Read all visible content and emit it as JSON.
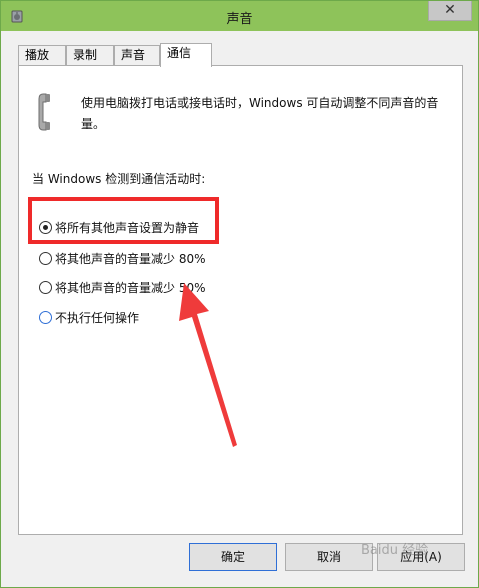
{
  "window": {
    "title": "声音"
  },
  "tabs": [
    {
      "label": "播放"
    },
    {
      "label": "录制"
    },
    {
      "label": "声音"
    },
    {
      "label": "通信"
    }
  ],
  "panel": {
    "description": "使用电脑拨打电话或接电话时，Windows 可自动调整不同声音的音量。",
    "section_label": "当 Windows 检测到通信活动时:",
    "options": [
      {
        "label": "将所有其他声音设置为静音",
        "checked": true
      },
      {
        "label": "将其他声音的音量减少 80%",
        "checked": false
      },
      {
        "label": "将其他声音的音量减少 50%",
        "checked": false
      },
      {
        "label": "不执行任何操作",
        "checked": false
      }
    ]
  },
  "buttons": {
    "ok": "确定",
    "cancel": "取消",
    "apply": "应用(A)"
  },
  "watermark": "Baidu 经验",
  "colors": {
    "titlebar": "#8ec35a",
    "highlight": "#ef2a2a",
    "arrow": "#ef3b3b"
  }
}
